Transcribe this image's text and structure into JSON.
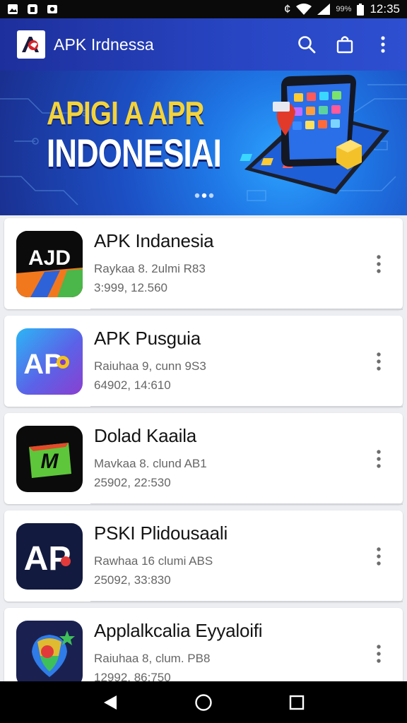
{
  "status_bar": {
    "time": "12:35",
    "battery_text": "99%",
    "carrier_glyph": "¢"
  },
  "app_bar": {
    "title": "APK Irdnessa",
    "icons": [
      "search-icon",
      "shopping-bag-icon",
      "more-vert-icon"
    ]
  },
  "banner": {
    "headline_line1": "APIGI A APR",
    "headline_line2": "INDONESIAI"
  },
  "apps": [
    {
      "name": "APK Indanesia",
      "meta1": "Raykaa 8. 2ulmi R83",
      "meta2": "3:999, 12.560",
      "icon_label": "AJD"
    },
    {
      "name": "APK Pusguia",
      "meta1": "Raiuhaa 9, cunn 9S3",
      "meta2": "64902, 14:610",
      "icon_label": "AP"
    },
    {
      "name": "Dolad Kaaila",
      "meta1": "Mavkaa 8. clund AB1",
      "meta2": "25902, 22:530",
      "icon_label": "M"
    },
    {
      "name": "PSKI Plidousaali",
      "meta1": "Rawhaa 16 clumi ABS",
      "meta2": "25092, 33:830",
      "icon_label": "AP"
    },
    {
      "name": "Applalkcalia Eyyaloifi",
      "meta1": "Raiuhaa 8, clum. PB8",
      "meta2": "12992, 86:750",
      "icon_label": ""
    }
  ],
  "colors": {
    "app_bar": "#2846c4",
    "banner_gold": "#f3d33a"
  }
}
